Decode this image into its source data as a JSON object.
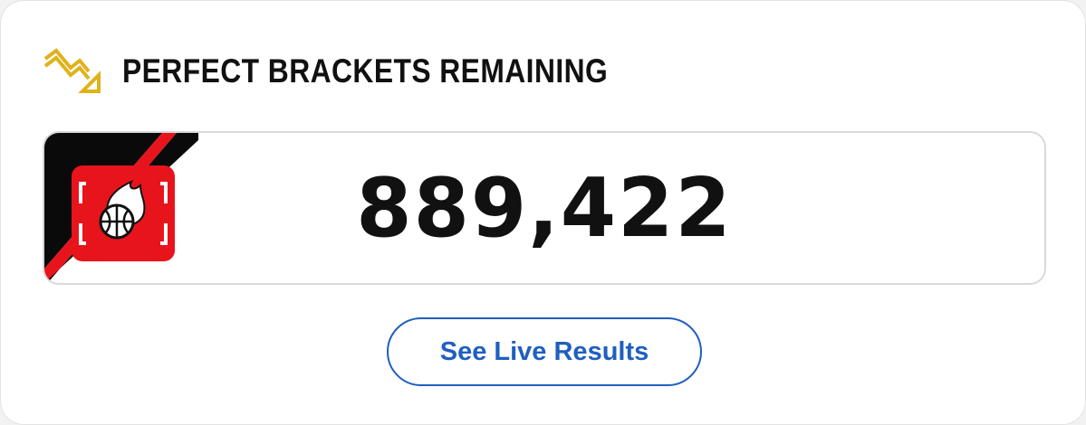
{
  "widget": {
    "title": "PERFECT BRACKETS REMAINING",
    "count": "889,422",
    "button_label": "See Live Results"
  },
  "icons": {
    "trend": "trend-down-arrow-icon",
    "logo": "flaming-basketball-logo-icon"
  },
  "colors": {
    "accent_gold": "#e0b21a",
    "logo_red": "#e8141c",
    "logo_black": "#0a0a0a",
    "button_blue": "#1f5fbf",
    "text": "#111111"
  }
}
